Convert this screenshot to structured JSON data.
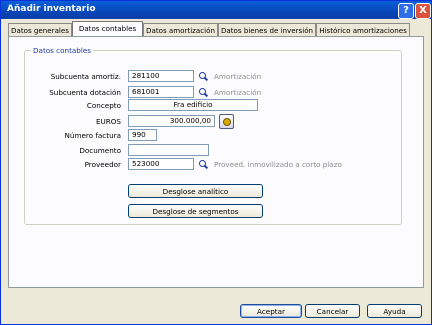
{
  "window": {
    "title": "Añadir inventario",
    "help_label": "?",
    "close_label": "X"
  },
  "tabs": [
    "Datos generales",
    "Datos contables",
    "Datos amortización",
    "Datos bienes de inversión",
    "Histórico amortizaciones"
  ],
  "group": {
    "title": "Datos contables"
  },
  "fields": {
    "subcuenta_amortiz": {
      "label": "Subcuenta amortiz.",
      "value": "281100",
      "aux": "Amortización"
    },
    "subcuenta_dotacion": {
      "label": "Subcuenta dotación",
      "value": "681001",
      "aux": "Amortización"
    },
    "concepto": {
      "label": "Concepto",
      "value": "Fra edificio"
    },
    "euros": {
      "label": "EUROS",
      "value": "300.000,00"
    },
    "numero_factura": {
      "label": "Número factura",
      "value": "990"
    },
    "documento": {
      "label": "Documento",
      "value": ""
    },
    "proveedor": {
      "label": "Proveedor",
      "value": "523000",
      "aux": "Proveed. inmovilizado a corto plazo"
    }
  },
  "buttons": {
    "desglose_analitico": "Desglose analítico",
    "desglose_segmentos": "Desglose de segmentos",
    "aceptar": "Aceptar",
    "cancelar": "Cancelar",
    "ayuda": "Ayuda"
  },
  "icons": {
    "search": "search-icon",
    "currency": "euro-coin-icon"
  }
}
